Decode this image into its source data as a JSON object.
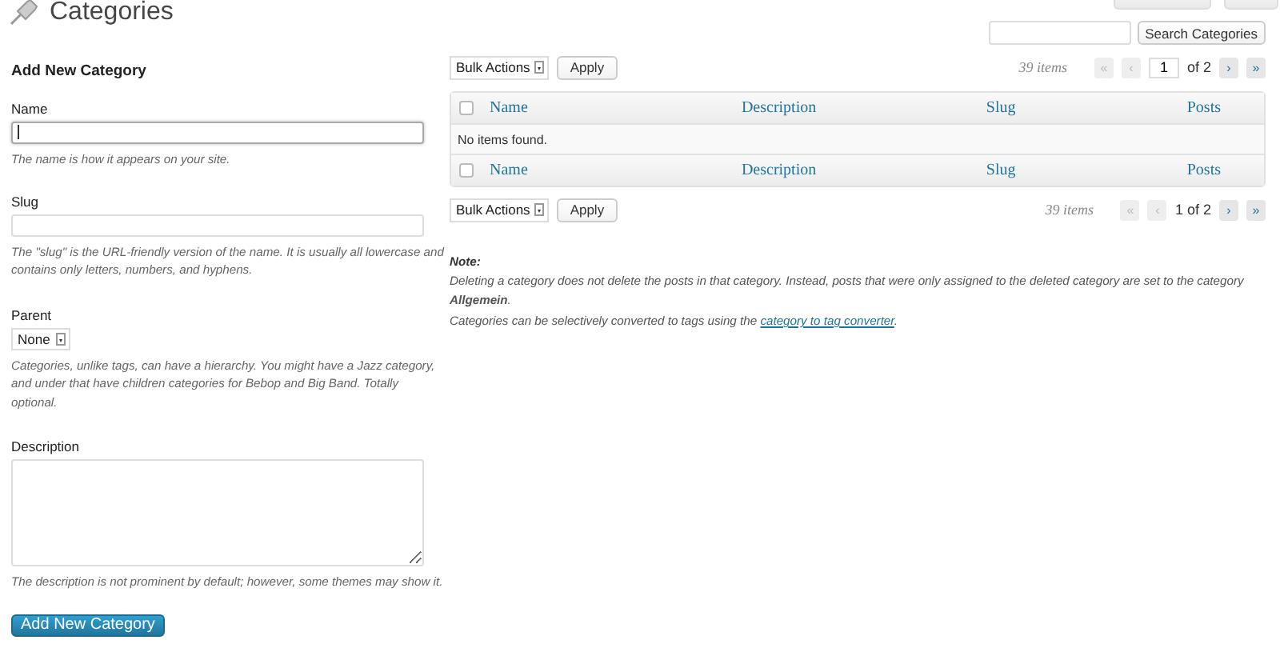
{
  "page": {
    "title": "Categories"
  },
  "form": {
    "heading": "Add New Category",
    "fields": [
      {
        "kind": "text",
        "label": "Name",
        "focused": true,
        "hint": "The name is how it appears on your site."
      },
      {
        "kind": "text",
        "label": "Slug",
        "focused": false,
        "hint": "The \"slug\" is the URL-friendly version of the name. It is usually all lowercase and contains only letters, numbers, and hyphens."
      },
      {
        "kind": "select",
        "label": "Parent",
        "value": "None",
        "hint": "Categories, unlike tags, can have a hierarchy. You might have a Jazz category, and under that have children categories for Bebop and Big Band. Totally optional."
      },
      {
        "kind": "textarea",
        "label": "Description",
        "hint": "The description is not prominent by default; however, some themes may show it."
      }
    ],
    "submit": "Add New Category"
  },
  "search": {
    "button": "Search Categories"
  },
  "top_nav": {
    "bulk": "Bulk Actions",
    "apply": "Apply",
    "count": "39 items",
    "page": "1",
    "of": "of 2",
    "buttons": [
      {
        "label": "«",
        "disabled": true
      },
      {
        "label": "‹",
        "disabled": true
      },
      {
        "label": "›",
        "disabled": false
      },
      {
        "label": "»",
        "disabled": false
      }
    ]
  },
  "table": {
    "columns": [
      {
        "label": "Name",
        "checked": false
      },
      {
        "label": "Description"
      },
      {
        "label": "Slug"
      },
      {
        "label": "Posts"
      }
    ],
    "empty": "No items found.",
    "footer_columns": [
      {
        "label": "Name",
        "checked": false
      },
      {
        "label": "Description"
      },
      {
        "label": "Slug"
      },
      {
        "label": "Posts"
      }
    ]
  },
  "bottom_nav": {
    "bulk": "Bulk Actions",
    "apply": "Apply",
    "count": "39 items",
    "pages": "1 of 2",
    "buttons": [
      {
        "label": "«",
        "disabled": true
      },
      {
        "label": "‹",
        "disabled": true
      },
      {
        "label": "›",
        "disabled": false
      },
      {
        "label": "»",
        "disabled": false
      }
    ]
  },
  "note": {
    "label": "Note:",
    "text": "Deleting a category does not delete the posts in that category. Instead, posts that were only assigned to the deleted category are set to the category **Allgemein**.",
    "convert_text": "Categories can be selectively converted to tags using the ",
    "link": "category to tag converter",
    "convert_end": "."
  }
}
